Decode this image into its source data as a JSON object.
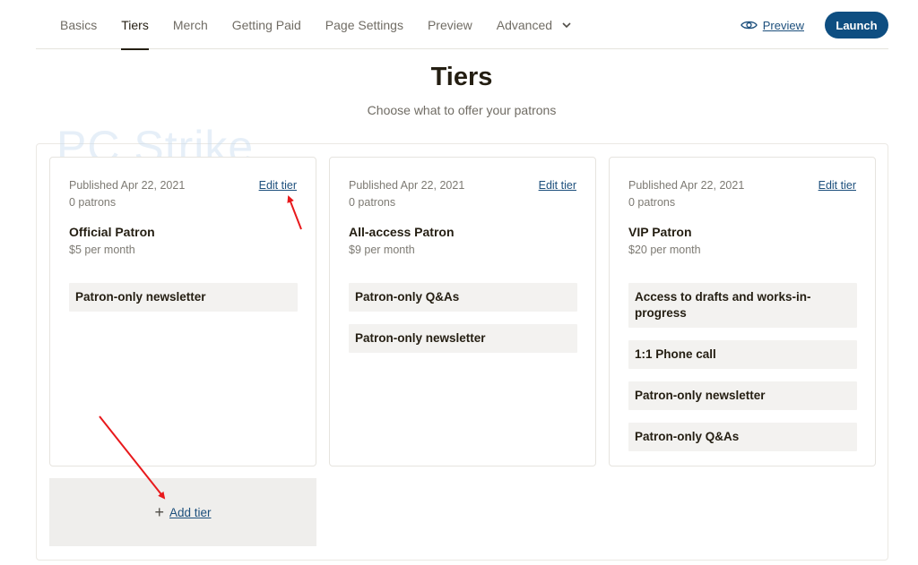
{
  "nav": {
    "tabs": [
      {
        "label": "Basics",
        "active": false
      },
      {
        "label": "Tiers",
        "active": true
      },
      {
        "label": "Merch",
        "active": false
      },
      {
        "label": "Getting Paid",
        "active": false
      },
      {
        "label": "Page Settings",
        "active": false
      },
      {
        "label": "Preview",
        "active": false
      },
      {
        "label": "Advanced",
        "active": false,
        "dropdown": true
      }
    ],
    "preview_link": "Preview",
    "preview_icon": "eye-icon",
    "launch_label": "Launch",
    "accent_color": "#0e4e81"
  },
  "header": {
    "title": "Tiers",
    "subtitle": "Choose what to offer your patrons"
  },
  "watermark": "PC Strike",
  "tiers": [
    {
      "published": "Published Apr 22, 2021",
      "patrons": "0 patrons",
      "edit_label": "Edit tier",
      "name": "Official Patron",
      "price": "$5 per month",
      "benefits": [
        "Patron-only newsletter"
      ]
    },
    {
      "published": "Published Apr 22, 2021",
      "patrons": "0 patrons",
      "edit_label": "Edit tier",
      "name": "All-access Patron",
      "price": "$9 per month",
      "benefits": [
        "Patron-only Q&As",
        "Patron-only newsletter"
      ]
    },
    {
      "published": "Published Apr 22, 2021",
      "patrons": "0 patrons",
      "edit_label": "Edit tier",
      "name": "VIP Patron",
      "price": "$20 per month",
      "benefits": [
        "Access to drafts and works-in-progress",
        "1:1 Phone call",
        "Patron-only newsletter",
        "Patron-only Q&As"
      ]
    }
  ],
  "add_tier": {
    "icon": "plus-icon",
    "label": "Add tier"
  }
}
